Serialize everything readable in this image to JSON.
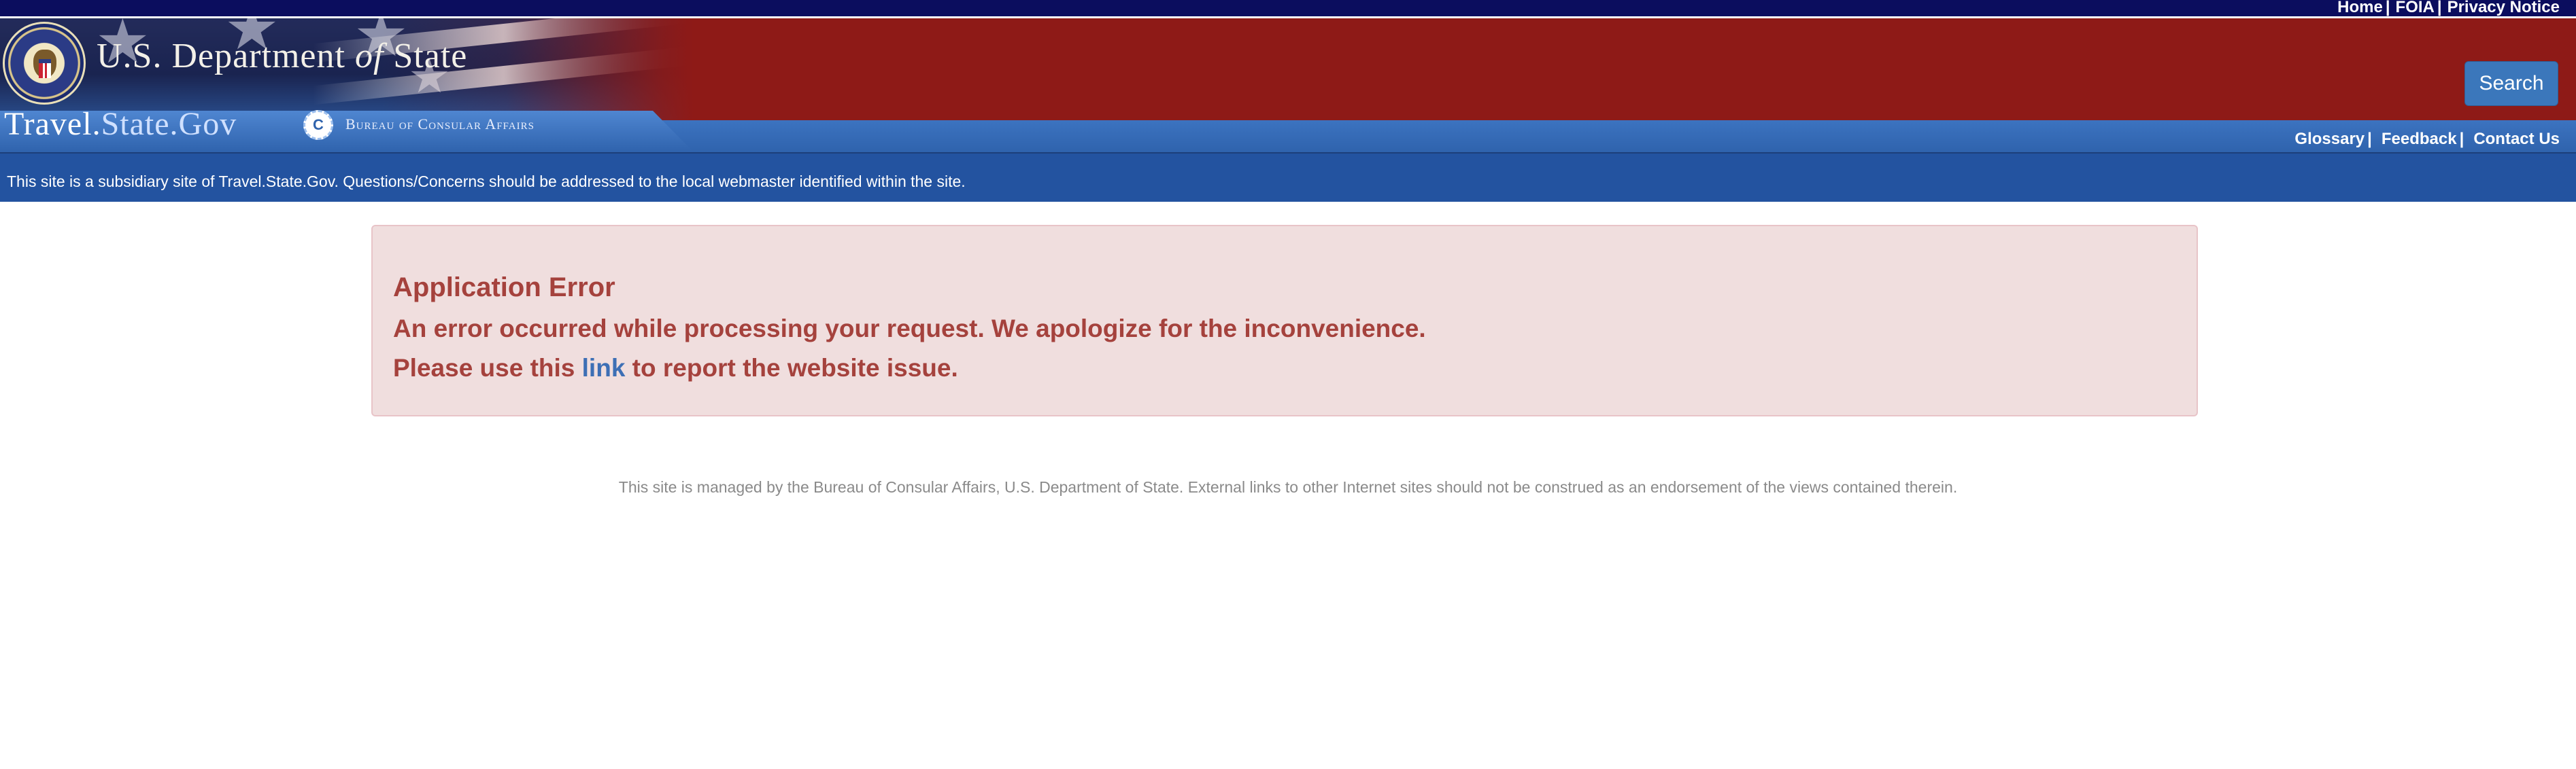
{
  "top_nav": {
    "links": [
      "Home",
      "FOIA",
      "Privacy Notice"
    ]
  },
  "header": {
    "department_title_pre": "U.S. Department",
    "department_title_of": "of",
    "department_title_post": "State",
    "travel_site_name_main": "Travel.",
    "travel_site_name_light": "State.Gov",
    "bureau": "Bureau of Consular Affairs",
    "bureau_logo_letter": "C",
    "search_label": "Search"
  },
  "sub_nav": {
    "links": [
      "Glossary",
      "Feedback",
      "Contact Us"
    ]
  },
  "notice": "This site is a subsidiary site of Travel.State.Gov. Questions/Concerns should be addressed to the local webmaster identified within the site.",
  "error": {
    "title": "Application Error",
    "message": "An error occurred while processing your request. We apologize for the inconvenience.",
    "report_prefix": "Please use this ",
    "report_link": "link",
    "report_suffix": " to report the website issue."
  },
  "footer": "This site is managed by the Bureau of Consular Affairs, U.S. Department of State. External links to other Internet sites should not be construed as an endorsement of the views contained therein.",
  "colors": {
    "topbar": "#0b0d5e",
    "banner_red": "#8e1a17",
    "travel_blue": "#2f63ad",
    "notice_blue": "#2353a0",
    "error_text": "#a5423d",
    "error_bg": "#f0dede",
    "link_blue": "#3d6fb5"
  }
}
